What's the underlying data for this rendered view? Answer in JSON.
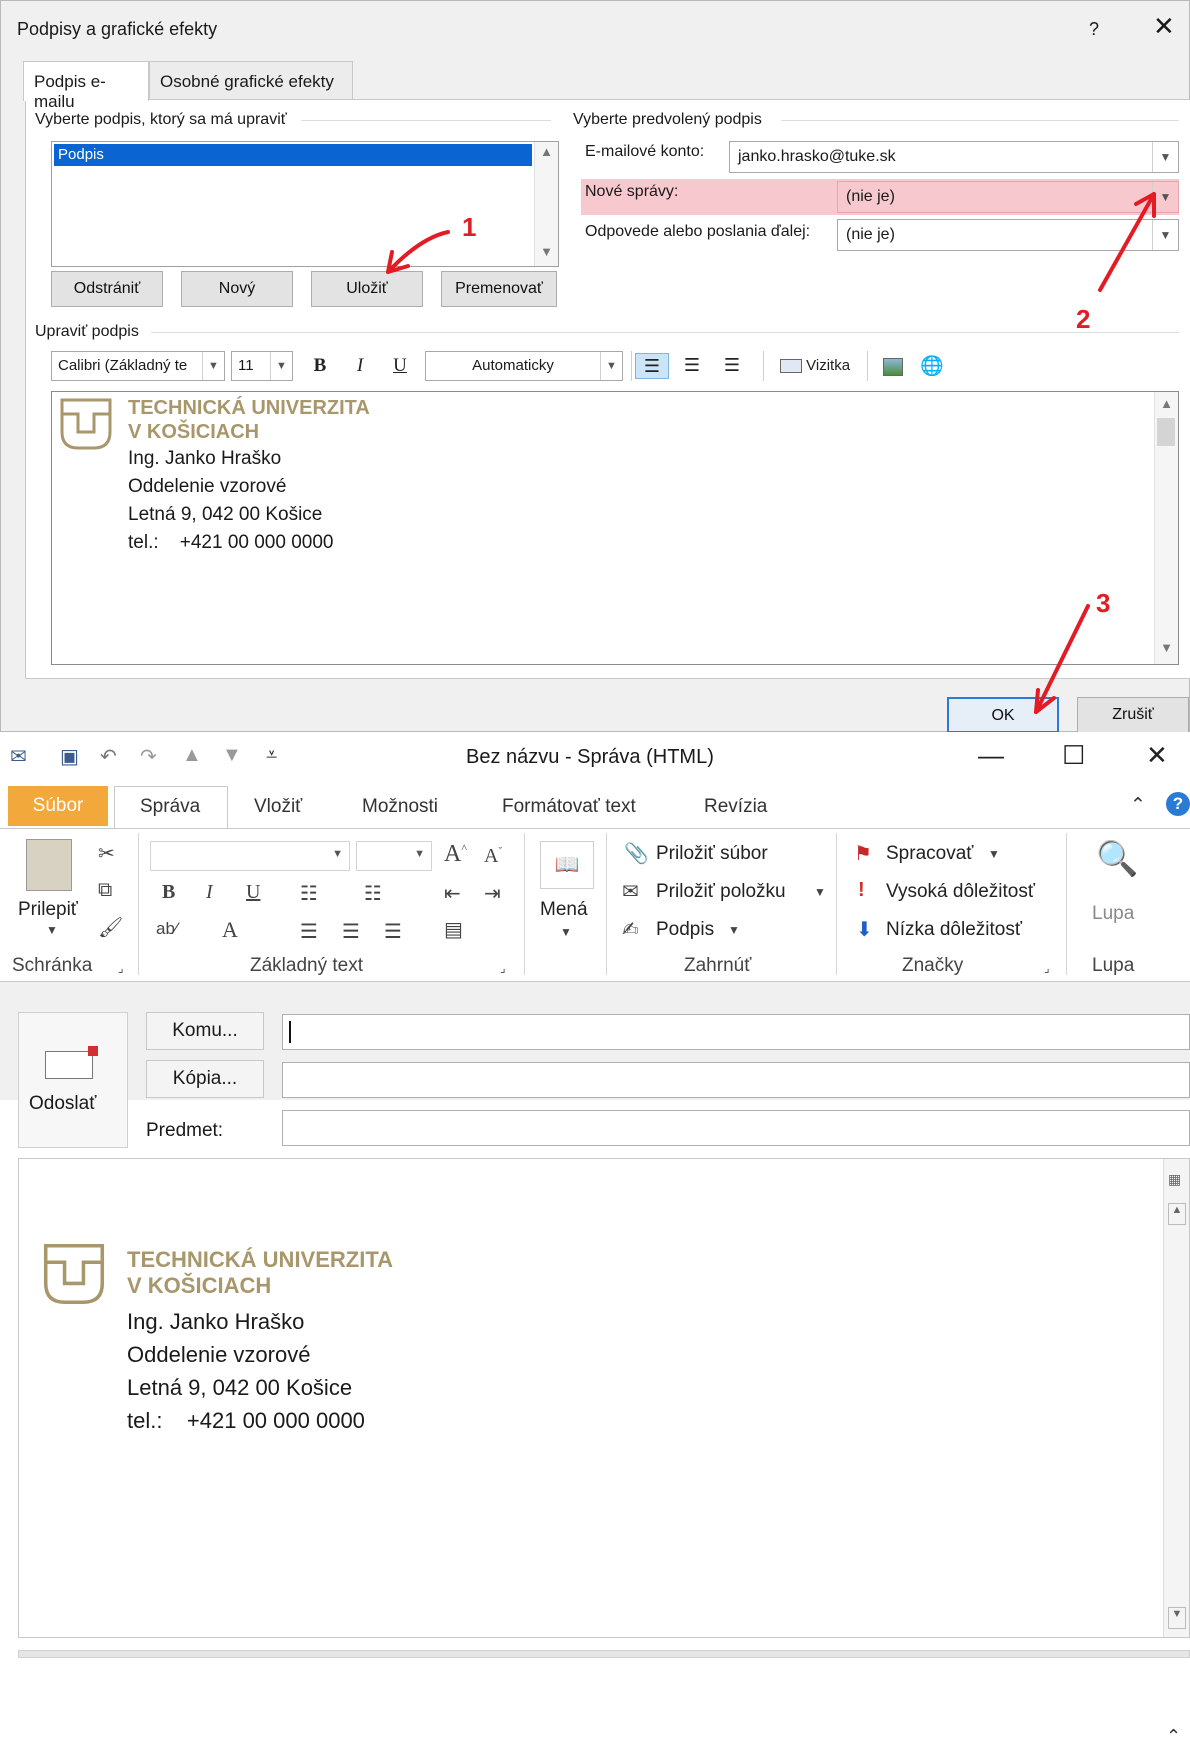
{
  "dialog": {
    "title": "Podpisy a grafické efekty",
    "help": "?",
    "close": "✕",
    "tabs": [
      "Podpis e-mailu",
      "Osobné grafické efekty"
    ],
    "select_label": "Vyberte podpis, ktorý sa má upraviť",
    "signatures": [
      "Podpis"
    ],
    "default_label": "Vyberte predvolený podpis",
    "account_label": "E-mailové konto:",
    "account_value": "janko.hrasko@tuke.sk",
    "new_label": "Nové správy:",
    "new_value": "(nie je)",
    "reply_label": "Odpovede alebo poslania ďalej:",
    "reply_value": "(nie je)",
    "buttons": {
      "delete": "Odstrániť",
      "new": "Nový",
      "save": "Uložiť",
      "rename": "Premenovať",
      "ok": "OK",
      "cancel": "Zrušiť"
    },
    "edit_label": "Upraviť podpis",
    "font_name": "Calibri (Základný te",
    "font_size": "11",
    "color": "Automaticky",
    "vizitka": "Vizitka"
  },
  "signature": {
    "uni_line1": "TECHNICKÁ UNIVERZITA",
    "uni_line2": "V KOŠICIACH",
    "name": "Ing. Janko Hraško",
    "dept": "Oddelenie vzorové",
    "address": "Letná 9, 042 00 Košice",
    "tel": "tel.:    +421 00 000 0000"
  },
  "annotations": [
    "1",
    "2",
    "3"
  ],
  "window": {
    "title": "Bez názvu  -  Správa (HTML)",
    "tabs": {
      "file": "Súbor",
      "message": "Správa",
      "insert": "Vložiť",
      "options": "Možnosti",
      "format": "Formátovať text",
      "review": "Revízia"
    },
    "groups": {
      "clipboard": "Schránka",
      "basic_text": "Základný text",
      "include": "Zahrnúť",
      "tags": "Značky",
      "zoom": "Lupa"
    },
    "paste": "Prilepiť",
    "names": "Mená",
    "attach_file": "Priložiť súbor",
    "attach_item": "Priložiť položku",
    "signature_btn": "Podpis",
    "follow_up": "Spracovať",
    "high_importance": "Vysoká dôležitosť",
    "low_importance": "Nízka dôležitosť",
    "zoom_btn": "Lupa",
    "send": "Odoslať",
    "to": "Komu...",
    "cc": "Kópia...",
    "subject": "Predmet:",
    "accent": "#f2a83a"
  }
}
